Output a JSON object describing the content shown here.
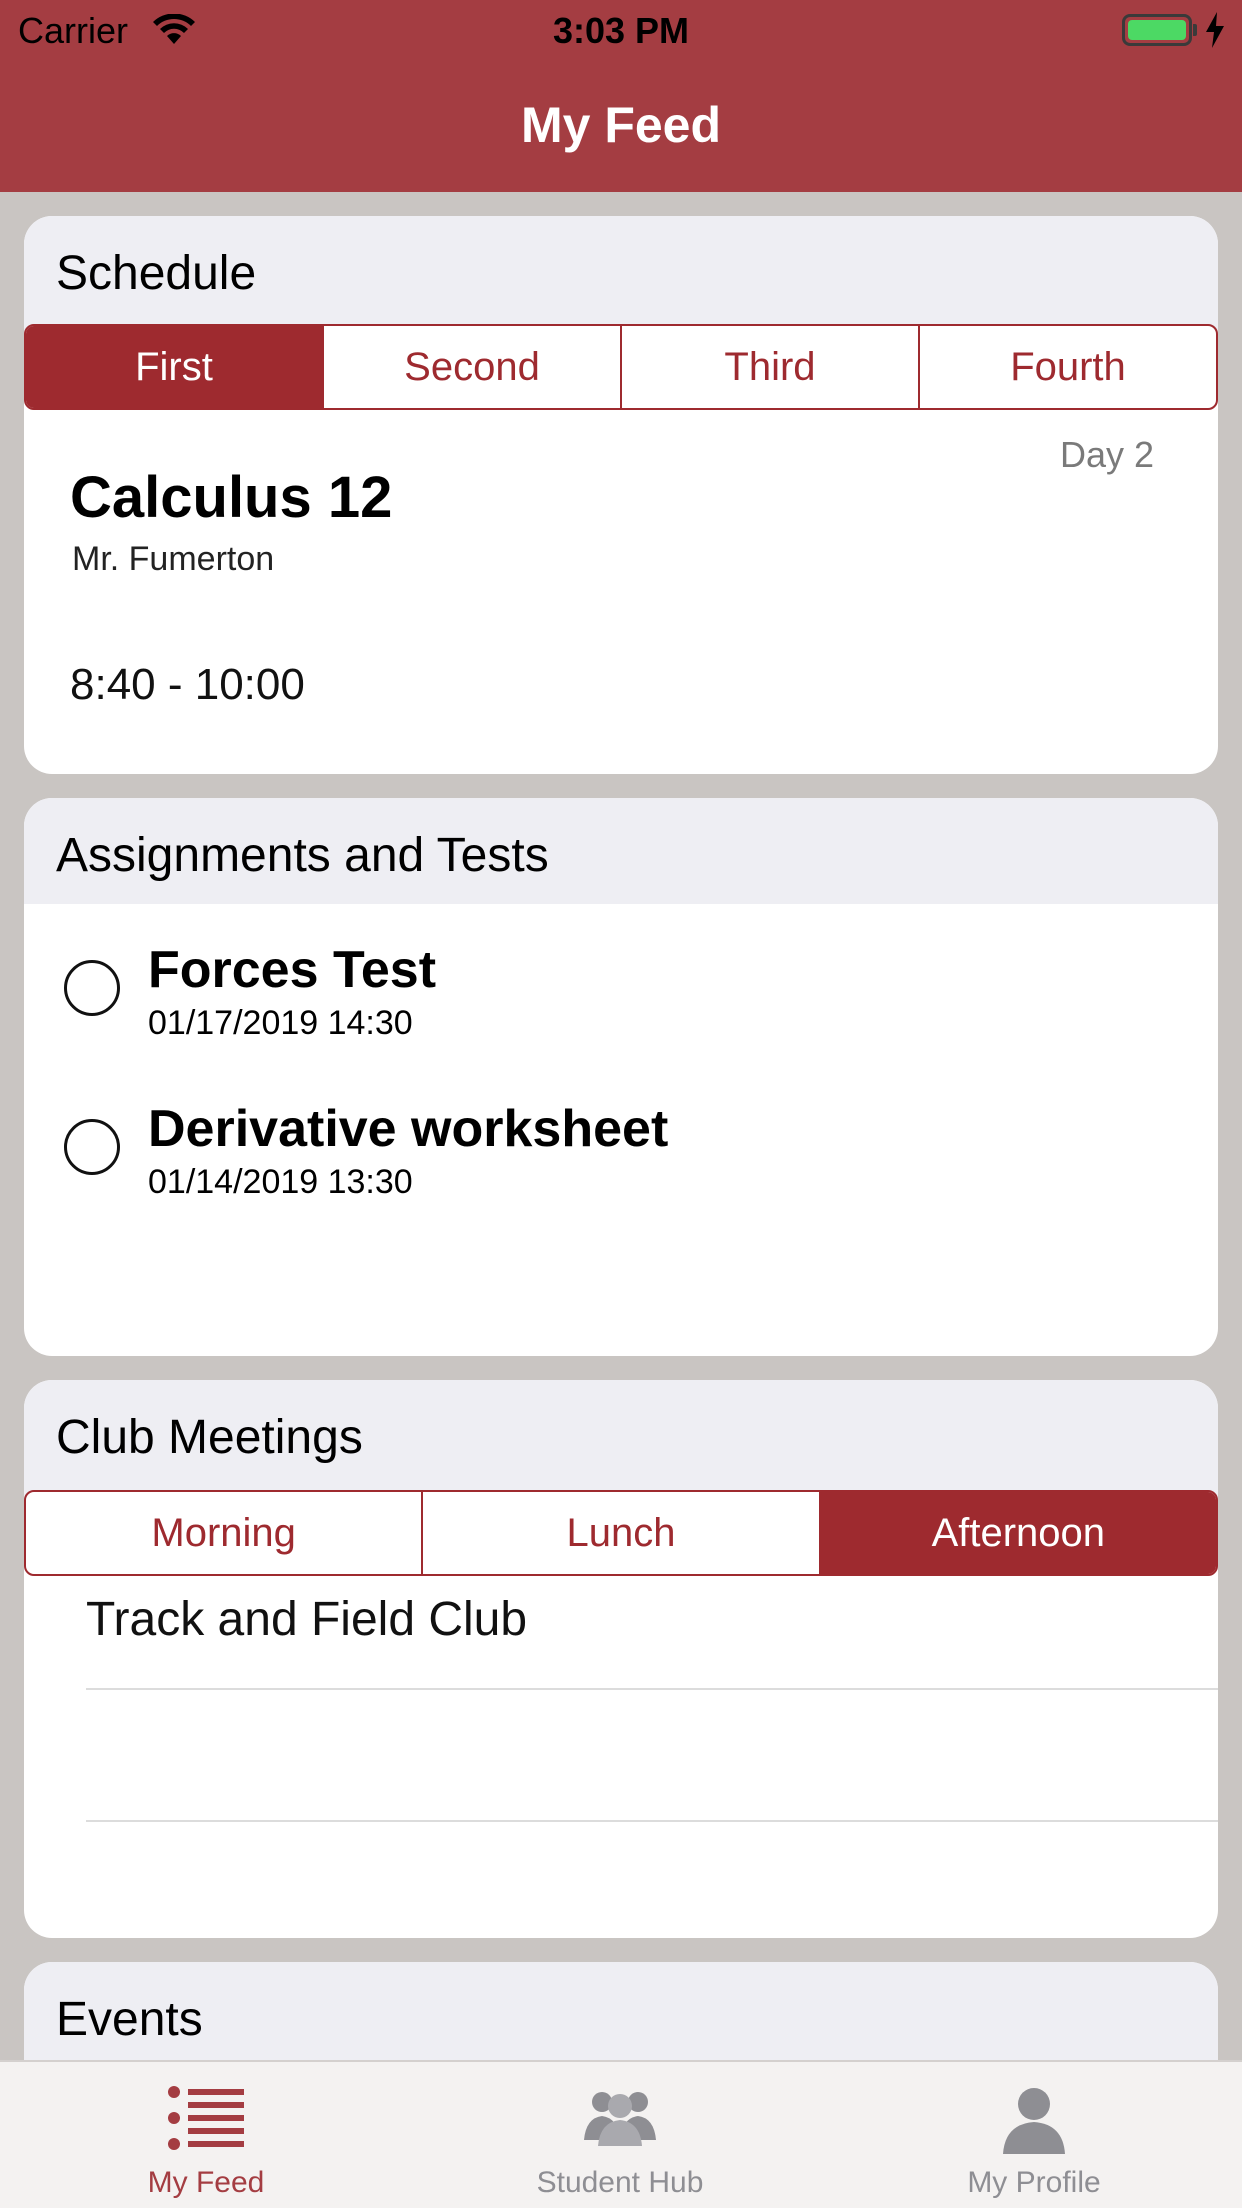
{
  "status_bar": {
    "carrier": "Carrier",
    "time": "3:03 PM"
  },
  "header": {
    "title": "My Feed"
  },
  "schedule": {
    "title": "Schedule",
    "tabs": [
      "First",
      "Second",
      "Third",
      "Fourth"
    ],
    "active_tab": "First",
    "day": "Day 2",
    "class_name": "Calculus 12",
    "teacher": "Mr. Fumerton",
    "time": "8:40 - 10:00"
  },
  "assignments": {
    "title": "Assignments and Tests",
    "items": [
      {
        "title": "Forces Test",
        "date": "01/17/2019 14:30"
      },
      {
        "title": "Derivative worksheet",
        "date": "01/14/2019 13:30"
      }
    ]
  },
  "clubs": {
    "title": "Club Meetings",
    "tabs": [
      "Morning",
      "Lunch",
      "Afternoon"
    ],
    "active_tab": "Afternoon",
    "items": [
      "Track and Field Club",
      ""
    ]
  },
  "events": {
    "title": "Events"
  },
  "tabbar": {
    "items": [
      {
        "label": "My Feed",
        "icon": "list-icon",
        "active": true
      },
      {
        "label": "Student Hub",
        "icon": "group-icon",
        "active": false
      },
      {
        "label": "My Profile",
        "icon": "person-icon",
        "active": false
      }
    ]
  },
  "colors": {
    "brand": "#a43d42",
    "segment": "#9e2a2f",
    "background": "#c9c5c2"
  }
}
